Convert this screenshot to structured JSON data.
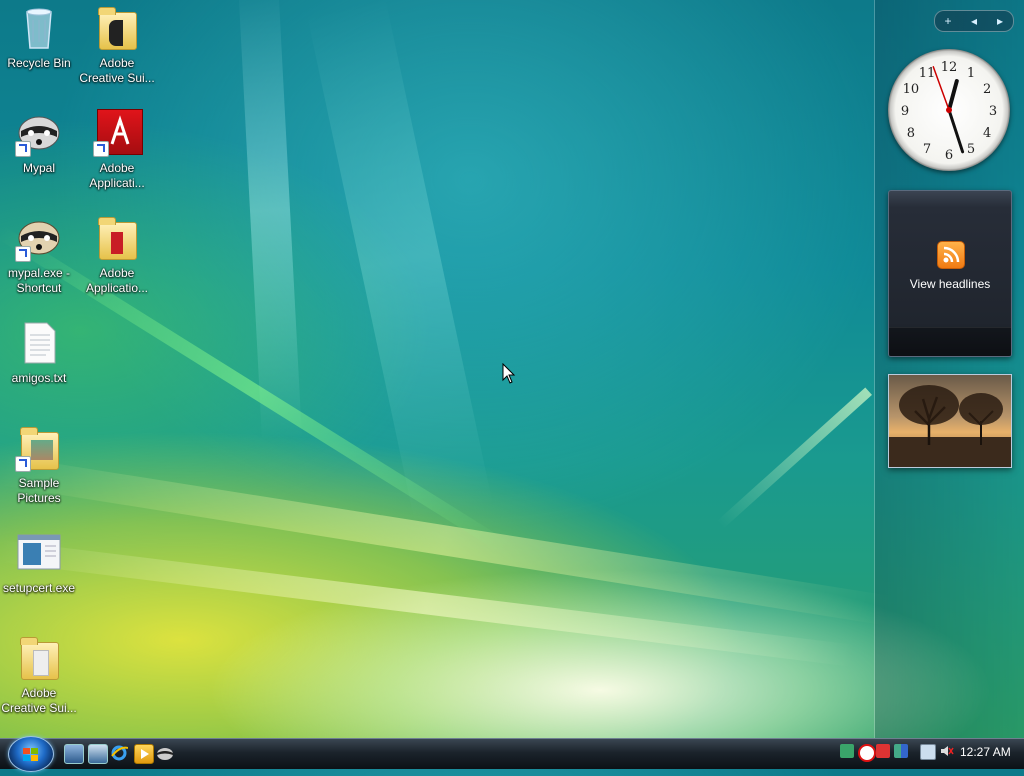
{
  "desktop": {
    "icons": [
      {
        "label_l1": "Recycle Bin",
        "label_l2": ""
      },
      {
        "label_l1": "Adobe",
        "label_l2": "Creative Sui..."
      },
      {
        "label_l1": "Mypal",
        "label_l2": ""
      },
      {
        "label_l1": "Adobe",
        "label_l2": "Applicati..."
      },
      {
        "label_l1": "mypal.exe -",
        "label_l2": "Shortcut"
      },
      {
        "label_l1": "Adobe",
        "label_l2": "Applicatio..."
      },
      {
        "label_l1": "amigos.txt",
        "label_l2": ""
      },
      {
        "label_l1": "Sample",
        "label_l2": "Pictures"
      },
      {
        "label_l1": "setupcert.exe",
        "label_l2": ""
      },
      {
        "label_l1": "Adobe",
        "label_l2": "Creative Sui..."
      }
    ]
  },
  "sidebar": {
    "controls": {
      "add": "+",
      "prev": "◂",
      "next": "▸"
    },
    "clock": {
      "numerals": [
        "12",
        "1",
        "2",
        "3",
        "4",
        "5",
        "6",
        "7",
        "8",
        "9",
        "10",
        "11"
      ]
    },
    "feeds": {
      "action_label": "View headlines"
    }
  },
  "taskbar": {
    "quick_launch": [
      "show-desktop-icon",
      "switch-windows-icon",
      "internet-explorer-icon",
      "media-player-icon",
      "mypal-icon"
    ],
    "time": "12:27 AM"
  },
  "colors": {
    "taskbar": "#1b232b",
    "rss": "#f07a12",
    "accent": "#2a5bd7"
  }
}
